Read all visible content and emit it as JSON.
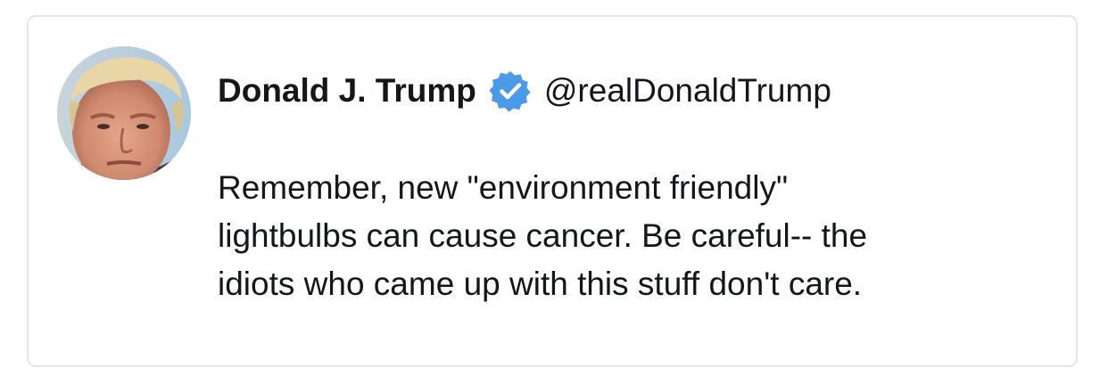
{
  "tweet": {
    "author": {
      "display_name": "Donald J. Trump",
      "handle": "@realDonaldTrump",
      "verified": true,
      "verified_badge_color": "#4a9ae8",
      "avatar": "profile-photo"
    },
    "text_lines": [
      "Remember, new \"environment friendly\"",
      "lightbulbs can cause cancer. Be careful-- the",
      "idiots who came up with this stuff don't care."
    ]
  },
  "colors": {
    "text": "#14171a",
    "border": "#e6e6e6",
    "background": "#ffffff"
  }
}
